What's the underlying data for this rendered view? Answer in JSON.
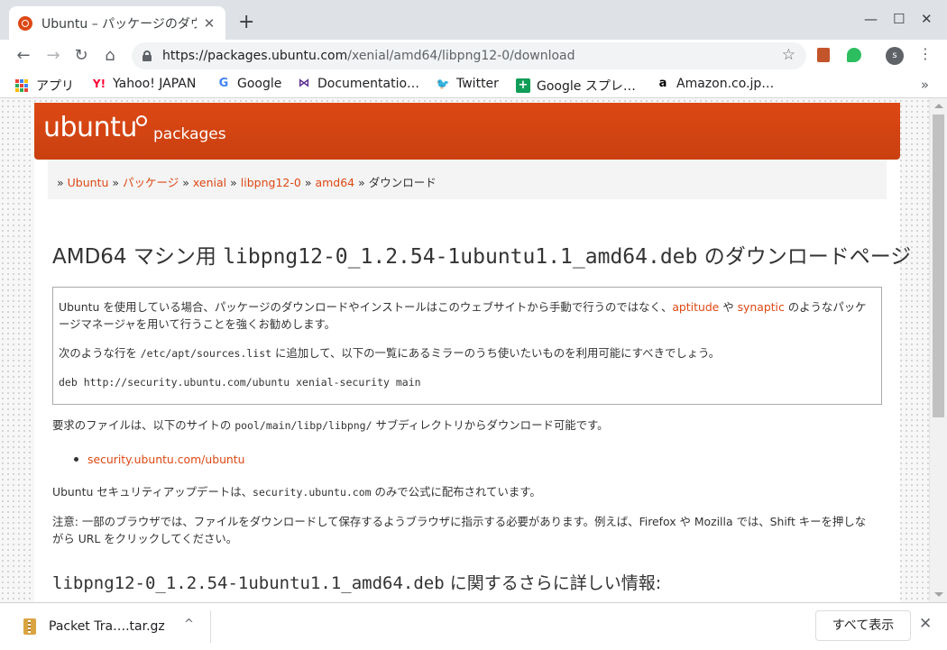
{
  "browser": {
    "tab": {
      "title": "Ubuntu – パッケージのダウ",
      "close": "✕"
    },
    "new_tab": "+",
    "window_controls": {
      "minimize": "—",
      "maximize": "☐",
      "close": "✕"
    },
    "nav": {
      "back": "←",
      "forward": "→",
      "reload": "↻",
      "home": "⌂"
    },
    "address": {
      "host": "https://packages.ubuntu.com",
      "path": "/xenial/amd64/libpng12-0/download"
    },
    "star": "☆",
    "profile_initial": "s",
    "menu": "⋮"
  },
  "bookmarks": [
    {
      "label": "アプリ",
      "icon": "apps-grid"
    },
    {
      "label": "Yahoo! JAPAN",
      "icon": "Y!",
      "color": "#ff0033"
    },
    {
      "label": "Google",
      "icon": "G",
      "color": "#4285f4"
    },
    {
      "label": "Documentatio…",
      "icon": "⋈",
      "color": "#5c2d91"
    },
    {
      "label": "Twitter",
      "icon": "🐦",
      "color": "#1da1f2"
    },
    {
      "label": "Google スプレ…",
      "icon": "+",
      "color": "#0f9d58"
    },
    {
      "label": "Amazon.co.jp…",
      "icon": "a",
      "color": "#000000"
    }
  ],
  "bookmarks_more": "»",
  "site": {
    "logo_text": "ubuntu",
    "logo_sub": "packages",
    "accent": "#dd4814",
    "breadcrumb": [
      {
        "text": "Ubuntu",
        "link": true
      },
      {
        "text": "パッケージ",
        "link": true
      },
      {
        "text": "xenial",
        "link": true
      },
      {
        "text": "libpng12-0",
        "link": true
      },
      {
        "text": "amd64",
        "link": true
      },
      {
        "text": "ダウンロード",
        "link": false
      }
    ],
    "breadcrumb_sep": "»",
    "title_prefix": "AMD64 マシン用 ",
    "title_file": "libpng12-0_1.2.54-1ubuntu1.1_amd64.deb",
    "title_suffix": " のダウンロードページ",
    "info": {
      "p1_a": "Ubuntu を使用している場合、パッケージのダウンロードやインストールはこのウェブサイトから手動で行うのではなく、",
      "aptitude": "aptitude",
      "p1_b": " や ",
      "synaptic": "synaptic",
      "p1_c": " のようなパッケージマネージャを用いて行うことを強くお勧めします。",
      "p2_a": "次のような行を ",
      "p2_code": "/etc/apt/sources.list",
      "p2_b": " に追加して、以下の一覧にあるミラーのうち使いたいものを利用可能にすべきでしょう。",
      "deb_line": "deb http://security.ubuntu.com/ubuntu xenial-security main"
    },
    "files_a": "要求のファイルは、以下のサイトの ",
    "files_code": "pool/main/libp/libpng/",
    "files_b": " サブディレクトリからダウンロード可能です。",
    "mirror": "security.ubuntu.com/ubuntu",
    "security_a": "Ubuntu セキュリティアップデートは、",
    "security_code": "security.ubuntu.com",
    "security_b": " のみで公式に配布されています。",
    "note": "注意: 一部のブラウザでは、ファイルをダウンロードして保存するようブラウザに指示する必要があります。例えば、Firefox や Mozilla では、Shift キーを押しながら URL をクリックしてください。",
    "more_file": "libpng12-0_1.2.54-1ubuntu1.1_amd64.deb",
    "more_suffix": " に関するさらに詳しい情報:"
  },
  "download_shelf": {
    "filename": "Packet Tra….tar.gz",
    "caret": "^",
    "show_all": "すべて表示",
    "close": "✕"
  }
}
